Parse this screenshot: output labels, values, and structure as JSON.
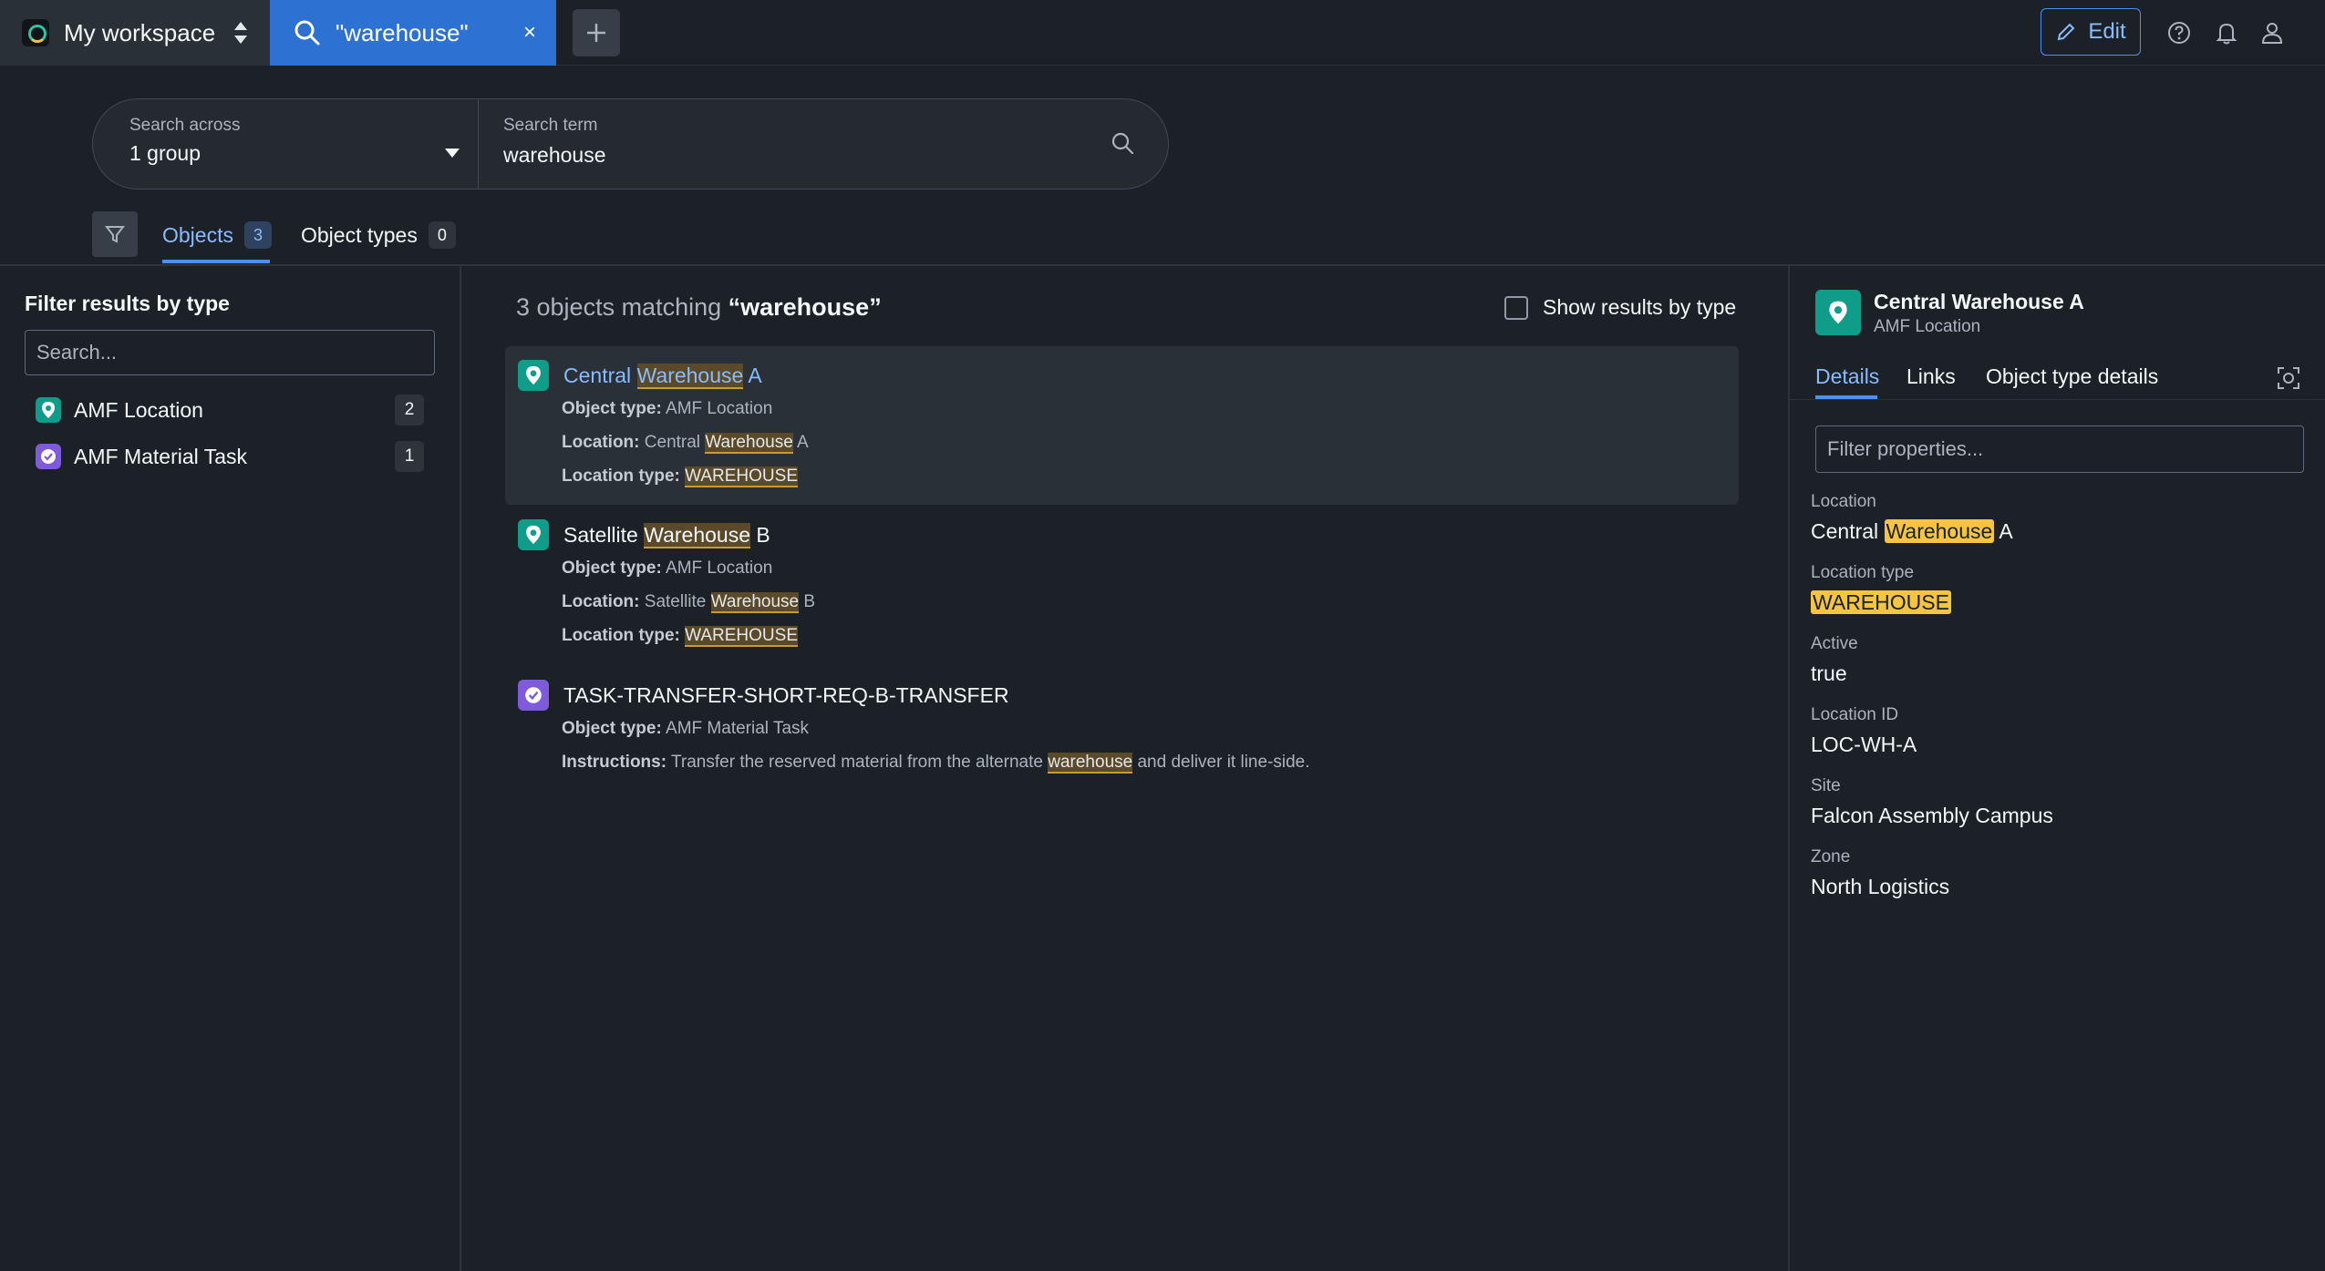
{
  "workspace": {
    "title": "My workspace"
  },
  "search_tab": {
    "label": "\"warehouse\"",
    "close": "×"
  },
  "toolbar": {
    "edit_label": "Edit"
  },
  "searchbox": {
    "scope_caption": "Search across",
    "scope_value": "1 group",
    "term_caption": "Search term",
    "term_value": "warehouse"
  },
  "tabs": [
    {
      "label": "Objects",
      "count": "3"
    },
    {
      "label": "Object types",
      "count": "0"
    }
  ],
  "filter_panel": {
    "title": "Filter results by type",
    "search_placeholder": "Search...",
    "types": [
      {
        "label": "AMF Location",
        "count": "2",
        "icon": "location-pin-icon"
      },
      {
        "label": "AMF Material Task",
        "count": "1",
        "icon": "task-check-icon"
      }
    ]
  },
  "results": {
    "summary_prefix": "3 objects matching",
    "summary_term": "“warehouse”",
    "show_by_type_label": "Show results by type",
    "items": [
      {
        "title_pre": "Central ",
        "title_hl": "Warehouse",
        "title_post": " A",
        "object_type_label": "Object type:",
        "object_type": "AMF Location",
        "location_label": "Location:",
        "location_pre": "Central ",
        "location_hl": "Warehouse",
        "location_post": " A",
        "location_type_label": "Location type:",
        "location_type": "WAREHOUSE"
      },
      {
        "title_pre": "Satellite ",
        "title_hl": "Warehouse",
        "title_post": " B",
        "object_type_label": "Object type:",
        "object_type": "AMF Location",
        "location_label": "Location:",
        "location_pre": "Satellite ",
        "location_hl": "Warehouse",
        "location_post": " B",
        "location_type_label": "Location type:",
        "location_type": "WAREHOUSE"
      },
      {
        "title": "TASK-TRANSFER-SHORT-REQ-B-TRANSFER",
        "object_type_label": "Object type:",
        "object_type": "AMF Material Task",
        "instructions_label": "Instructions:",
        "instructions_pre": "Transfer the reserved material from the alternate ",
        "instructions_hl": "warehouse",
        "instructions_post": " and deliver it line-side."
      }
    ]
  },
  "detail": {
    "title": "Central Warehouse A",
    "subtitle": "AMF Location",
    "tabs": [
      "Details",
      "Links",
      "Object type details"
    ],
    "filter_placeholder": "Filter properties...",
    "properties": [
      {
        "label": "Location",
        "pre": "Central ",
        "hl": "Warehouse",
        "post": " A"
      },
      {
        "label": "Location type",
        "hl": "WAREHOUSE"
      },
      {
        "label": "Active",
        "value": "true"
      },
      {
        "label": "Location ID",
        "value": "LOC-WH-A"
      },
      {
        "label": "Site",
        "value": "Falcon Assembly Campus"
      },
      {
        "label": "Zone",
        "value": "North Logistics"
      }
    ]
  },
  "colors": {
    "accent": "#2d72d2",
    "link": "#8abbff",
    "location_icon": "#0f9d8a",
    "task_icon": "#7d5bdb",
    "highlight": "#f5c542"
  }
}
